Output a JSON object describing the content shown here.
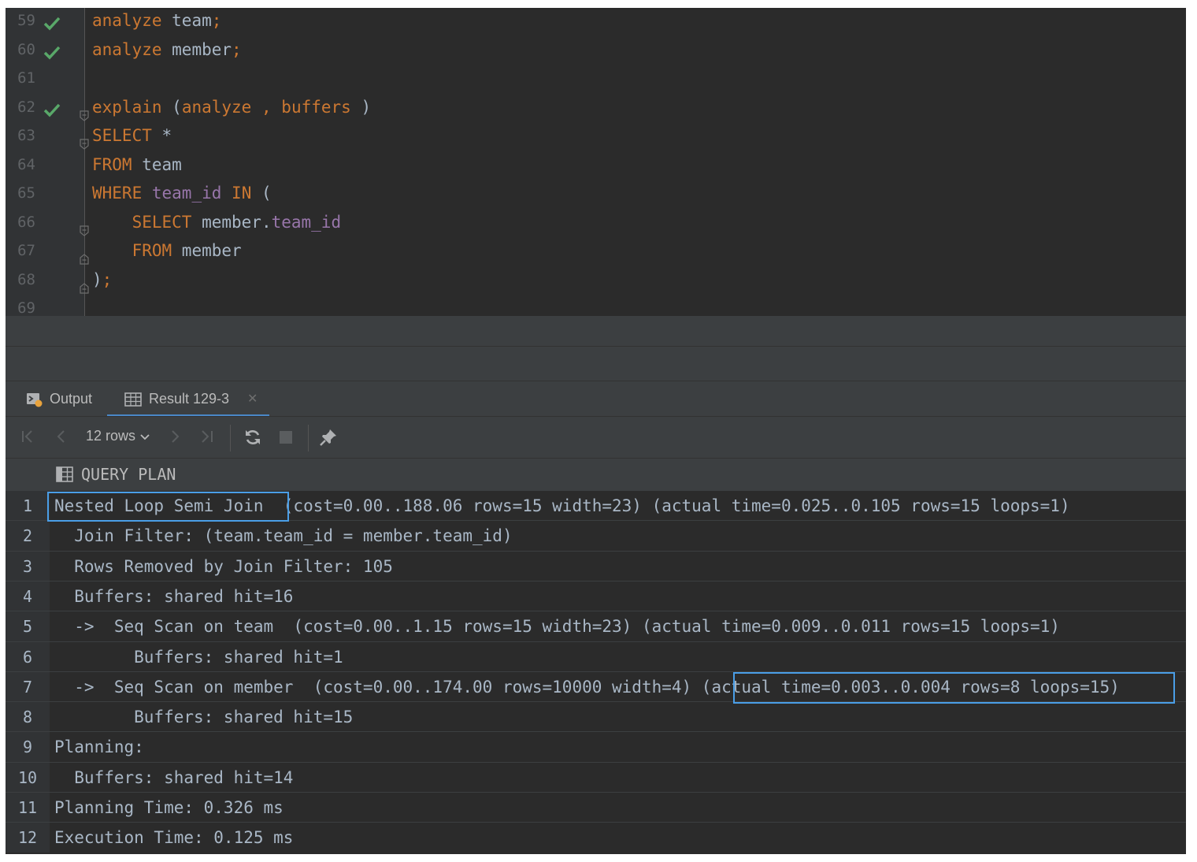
{
  "editor": {
    "lines": [
      {
        "num": "59",
        "status": "check-icon",
        "fold": "",
        "code": [
          {
            "t": "analyze",
            "c": "kw"
          },
          {
            "t": " team",
            "c": ""
          },
          {
            "t": ";",
            "c": "kw"
          }
        ]
      },
      {
        "num": "60",
        "status": "check-icon",
        "fold": "",
        "code": [
          {
            "t": "analyze",
            "c": "kw"
          },
          {
            "t": " member",
            "c": ""
          },
          {
            "t": ";",
            "c": "kw"
          }
        ]
      },
      {
        "num": "61",
        "status": "",
        "fold": "",
        "code": []
      },
      {
        "num": "62",
        "status": "check-icon",
        "fold": "open",
        "code": [
          {
            "t": "explain",
            "c": "kw"
          },
          {
            "t": " (",
            "c": ""
          },
          {
            "t": "analyze",
            "c": "kw"
          },
          {
            "t": " ",
            "c": ""
          },
          {
            "t": ",",
            "c": "kw"
          },
          {
            "t": " ",
            "c": ""
          },
          {
            "t": "buffers",
            "c": "kw"
          },
          {
            "t": " )",
            "c": ""
          }
        ]
      },
      {
        "num": "63",
        "status": "",
        "fold": "open",
        "code": [
          {
            "t": "SELECT",
            "c": "kw"
          },
          {
            "t": " *",
            "c": ""
          }
        ]
      },
      {
        "num": "64",
        "status": "",
        "fold": "",
        "code": [
          {
            "t": "FROM",
            "c": "kw"
          },
          {
            "t": " team",
            "c": ""
          }
        ]
      },
      {
        "num": "65",
        "status": "",
        "fold": "",
        "code": [
          {
            "t": "WHERE",
            "c": "kw"
          },
          {
            "t": " ",
            "c": ""
          },
          {
            "t": "team_id",
            "c": "col"
          },
          {
            "t": " ",
            "c": ""
          },
          {
            "t": "IN",
            "c": "kw"
          },
          {
            "t": " (",
            "c": ""
          }
        ]
      },
      {
        "num": "66",
        "status": "",
        "fold": "open",
        "code": [
          {
            "t": "    ",
            "c": ""
          },
          {
            "t": "SELECT",
            "c": "kw"
          },
          {
            "t": " member.",
            "c": ""
          },
          {
            "t": "team_id",
            "c": "col"
          }
        ]
      },
      {
        "num": "67",
        "status": "",
        "fold": "close",
        "code": [
          {
            "t": "    ",
            "c": ""
          },
          {
            "t": "FROM",
            "c": "kw"
          },
          {
            "t": " member",
            "c": ""
          }
        ]
      },
      {
        "num": "68",
        "status": "",
        "fold": "close",
        "code": [
          {
            "t": ")",
            "c": ""
          },
          {
            "t": ";",
            "c": "kw"
          }
        ]
      },
      {
        "num": "69",
        "status": "",
        "fold": "",
        "code": []
      }
    ]
  },
  "tabs": {
    "output_label": "Output",
    "result_label": "Result 129-3"
  },
  "toolbar": {
    "rows_label": "12 rows"
  },
  "grid": {
    "column_header": "QUERY PLAN",
    "rows": [
      {
        "num": "1",
        "text": "Nested Loop Semi Join  (cost=0.00..188.06 rows=15 width=23) (actual time=0.025..0.105 rows=15 loops=1)"
      },
      {
        "num": "2",
        "text": "  Join Filter: (team.team_id = member.team_id)"
      },
      {
        "num": "3",
        "text": "  Rows Removed by Join Filter: 105"
      },
      {
        "num": "4",
        "text": "  Buffers: shared hit=16"
      },
      {
        "num": "5",
        "text": "  ->  Seq Scan on team  (cost=0.00..1.15 rows=15 width=23) (actual time=0.009..0.011 rows=15 loops=1)"
      },
      {
        "num": "6",
        "text": "        Buffers: shared hit=1"
      },
      {
        "num": "7",
        "text": "  ->  Seq Scan on member  (cost=0.00..174.00 rows=10000 width=4) (actual time=0.003..0.004 rows=8 loops=15)"
      },
      {
        "num": "8",
        "text": "        Buffers: shared hit=15"
      },
      {
        "num": "9",
        "text": "Planning:"
      },
      {
        "num": "10",
        "text": "  Buffers: shared hit=14"
      },
      {
        "num": "11",
        "text": "Planning Time: 0.326 ms"
      },
      {
        "num": "12",
        "text": "Execution Time: 0.125 ms"
      }
    ]
  },
  "colors": {
    "keyword": "#cc7832",
    "column": "#9876aa",
    "text": "#a9b7c6",
    "highlight_border": "#4a9ee7",
    "check": "#59a869"
  }
}
